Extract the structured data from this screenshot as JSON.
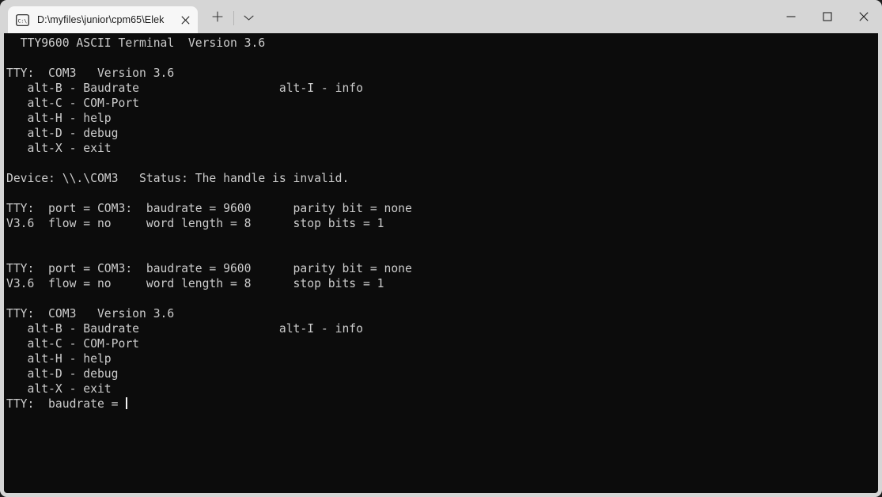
{
  "window": {
    "titlebar_color": "#d6d6d6",
    "tab": {
      "icon": "cmd-prompt-icon",
      "title": "D:\\myfiles\\junior\\cpm65\\Elek",
      "close_icon": "close-icon"
    },
    "new_tab_icon": "plus-icon",
    "tab_dropdown_icon": "chevron-down-icon",
    "controls": {
      "minimize_icon": "minimize-icon",
      "maximize_icon": "maximize-icon",
      "close_icon": "close-icon"
    }
  },
  "terminal": {
    "background_color": "#0c0c0c",
    "foreground_color": "#cccccc",
    "cursor": "|",
    "lines": [
      "  TTY9600 ASCII Terminal  Version 3.6",
      "",
      "TTY:  COM3   Version 3.6",
      "   alt-B - Baudrate                    alt-I - info",
      "   alt-C - COM-Port",
      "   alt-H - help",
      "   alt-D - debug",
      "   alt-X - exit",
      "",
      "Device: \\\\.\\COM3   Status: The handle is invalid.",
      "",
      "TTY:  port = COM3:  baudrate = 9600      parity bit = none",
      "V3.6  flow = no     word length = 8      stop bits = 1",
      "",
      "",
      "TTY:  port = COM3:  baudrate = 9600      parity bit = none",
      "V3.6  flow = no     word length = 8      stop bits = 1",
      "",
      "TTY:  COM3   Version 3.6",
      "   alt-B - Baudrate                    alt-I - info",
      "   alt-C - COM-Port",
      "   alt-H - help",
      "   alt-D - debug",
      "   alt-X - exit"
    ],
    "prompt_line": "TTY:  baudrate = "
  }
}
